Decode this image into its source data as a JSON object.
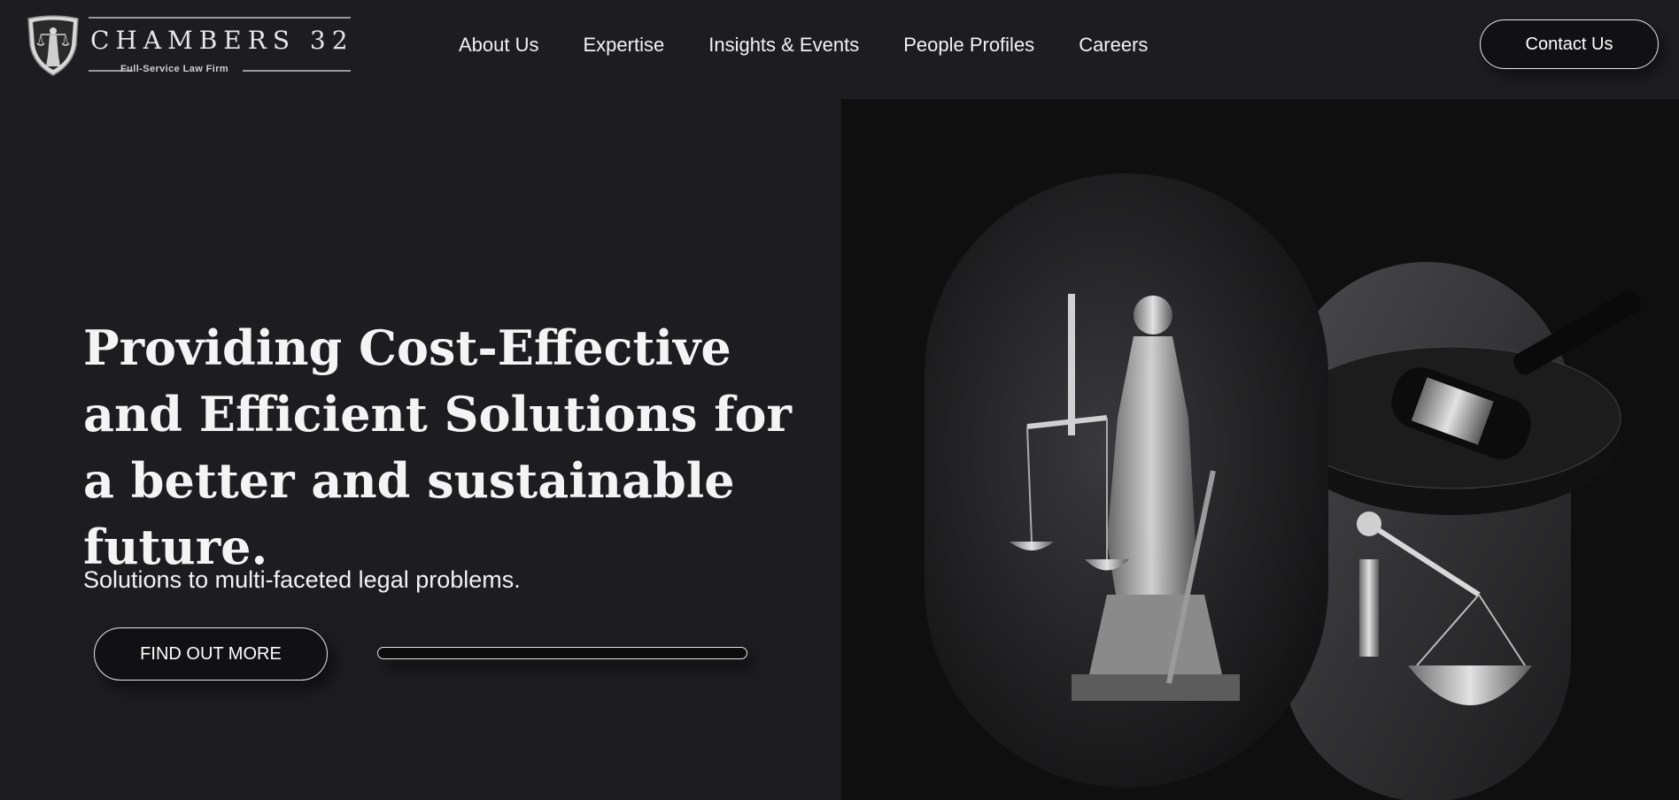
{
  "brand": {
    "name": "CHAMBERS 32",
    "tagline": "Full-Service Law Firm",
    "logo_icon": "lady-justice-shield-icon"
  },
  "nav": {
    "items": [
      {
        "label": "About Us"
      },
      {
        "label": "Expertise"
      },
      {
        "label": "Insights & Events"
      },
      {
        "label": "People Profiles"
      },
      {
        "label": "Careers"
      }
    ]
  },
  "header": {
    "contact_label": "Contact Us"
  },
  "hero": {
    "title": "Providing Cost-Effective and Efficient Solutions for a better and sustainable future.",
    "subtitle": "Solutions to multi-faceted legal problems.",
    "cta_label": "FIND OUT MORE",
    "progress": 0,
    "image_icons": [
      "lady-justice-statue-icon",
      "gavel-icon",
      "scales-icon"
    ]
  },
  "colors": {
    "background": "#1d1d20",
    "button_bg": "#111113",
    "text": "#f2f2f2",
    "image_bg": "#0f0f10"
  }
}
